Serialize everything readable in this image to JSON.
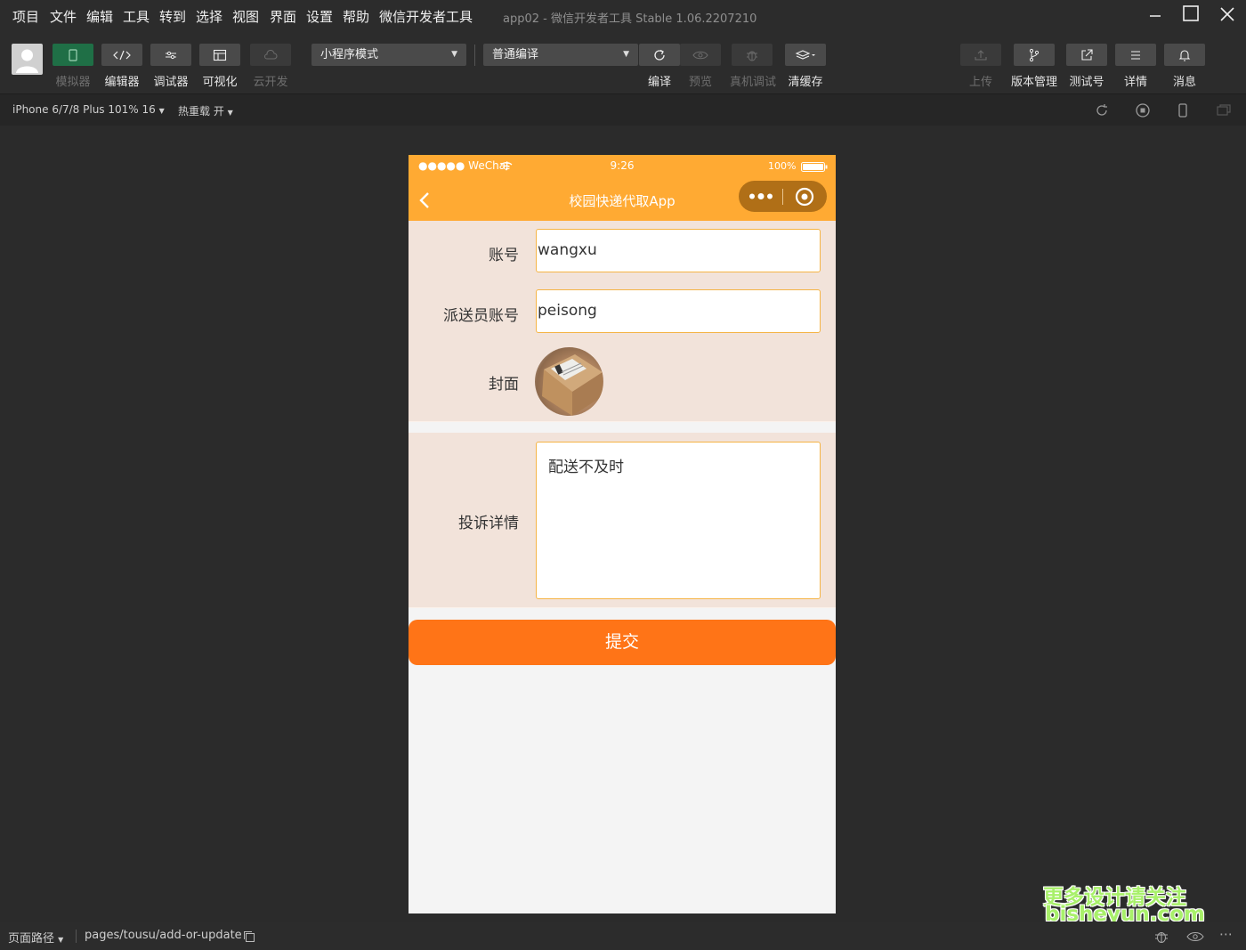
{
  "menu": {
    "items": [
      "项目",
      "文件",
      "编辑",
      "工具",
      "转到",
      "选择",
      "视图",
      "界面",
      "设置",
      "帮助",
      "微信开发者工具"
    ],
    "window_title": "app02 - 微信开发者工具 Stable 1.06.2207210"
  },
  "toolbar": {
    "simulator_label": "模拟器",
    "editor_label": "编辑器",
    "debugger_label": "调试器",
    "visual_label": "可视化",
    "cloud_label": "云开发",
    "mode_select": "小程序模式",
    "compile_select": "普通编译",
    "compile_label": "编译",
    "preview_label": "预览",
    "real_debug_label": "真机调试",
    "clear_cache_label": "清缓存",
    "upload_label": "上传",
    "version_label": "版本管理",
    "test_label": "测试号",
    "details_label": "详情",
    "messages_label": "消息"
  },
  "subbar": {
    "device": "iPhone 6/7/8 Plus 101% 16",
    "hot_reload": "热重载 开"
  },
  "phone": {
    "status": {
      "carrier": "●●●●● WeChat",
      "time": "9:26",
      "battery": "100%"
    },
    "nav_title": "校园快递代取App",
    "form": {
      "account_label": "账号",
      "account_value": "wangxu",
      "courier_label": "派送员账号",
      "courier_value": "peisong",
      "cover_label": "封面",
      "detail_label": "投诉详情",
      "detail_value": "配送不及时"
    },
    "submit_label": "提交"
  },
  "bottombar": {
    "path_label": "页面路径",
    "path": "pages/tousu/add-or-update"
  },
  "watermark": {
    "line1": "更多设计请关注",
    "line2": "bisheyun.com"
  },
  "colors": {
    "nav": "#ffaa33",
    "submit": "#ff7417",
    "form_bg": "#f2e3da",
    "input_border": "#f5b445"
  }
}
